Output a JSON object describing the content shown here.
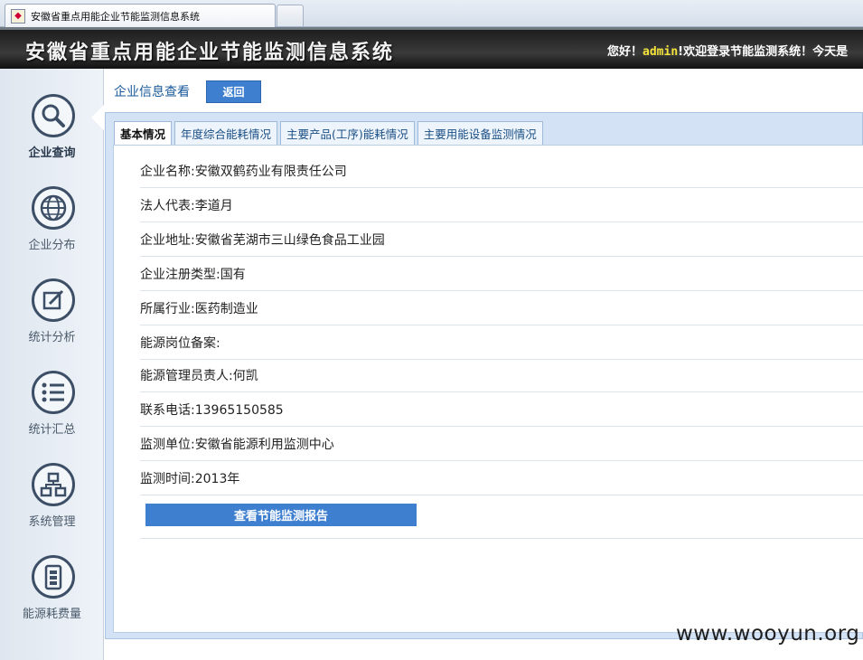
{
  "browser": {
    "tab_title": "安徽省重点用能企业节能监测信息系统"
  },
  "header": {
    "title": "安徽省重点用能企业节能监测信息系统",
    "greet_prefix": "您好！",
    "username": "admin",
    "greet_suffix": "!欢迎登录节能监测系统！今天是"
  },
  "nav": {
    "items": [
      {
        "label": "企业查询",
        "icon": "search-icon"
      },
      {
        "label": "企业分布",
        "icon": "globe-icon"
      },
      {
        "label": "统计分析",
        "icon": "edit-icon"
      },
      {
        "label": "统计汇总",
        "icon": "list-icon"
      },
      {
        "label": "系统管理",
        "icon": "org-chart-icon"
      },
      {
        "label": "能源耗费量",
        "icon": "battery-icon"
      }
    ]
  },
  "main": {
    "breadcrumb": "企业信息查看",
    "back_label": "返回",
    "tabs": [
      "基本情况",
      "年度综合能耗情况",
      "主要产品(工序)能耗情况",
      "主要用能设备监测情况"
    ],
    "fields": [
      "企业名称:安徽双鹤药业有限责任公司",
      "法人代表:李道月",
      "企业地址:安徽省芜湖市三山绿色食品工业园",
      "企业注册类型:国有",
      "所属行业:医药制造业",
      "能源岗位备案:",
      "能源管理员责人:何凯",
      "联系电话:13965150585",
      "监测单位:安徽省能源利用监测中心",
      "监测时间:2013年"
    ],
    "report_button": "查看节能监测报告"
  },
  "watermark": "www.wooyun.org"
}
